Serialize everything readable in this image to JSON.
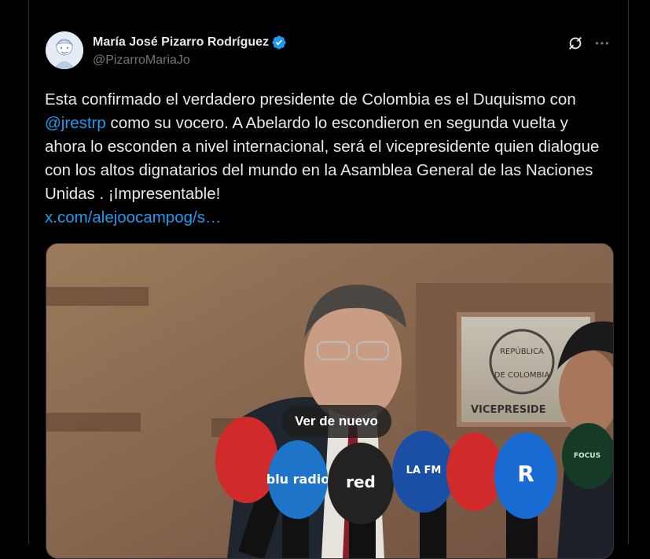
{
  "author": {
    "display_name": "María José Pizarro Rodríguez",
    "handle": "@PizarroMariaJo",
    "verified": true
  },
  "post": {
    "text_before_mention": "Esta confirmado el verdadero presidente de Colombia es el Duquismo con ",
    "mention": "@jrestrp",
    "text_after_mention": " como su vocero. A Abelardo lo escondieron en segunda vuelta y ahora lo esconden a nivel internacional, será el vicepresidente quien dialogue con los altos dignatarios del mundo en la Asamblea General de las Naciones Unidas . ¡Impresentable!",
    "link": "x.com/alejoocampog/s…"
  },
  "media": {
    "replay_label": "Ver de nuevo",
    "sign_text_line1": "REPÚBLICA",
    "sign_text_line2": "DE COLOMBIA",
    "sign_lower": "VICEPRESIDE",
    "mic_labels": [
      "blu radio",
      "red",
      "LA FM",
      "R",
      "FOCUS"
    ]
  },
  "icons": {
    "grok": "grok-icon",
    "more": "more-icon",
    "verified": "verified-badge-icon"
  },
  "colors": {
    "accent": "#1d9bf0",
    "background": "#000000",
    "text": "#e7e9ea",
    "muted": "#71767b"
  }
}
